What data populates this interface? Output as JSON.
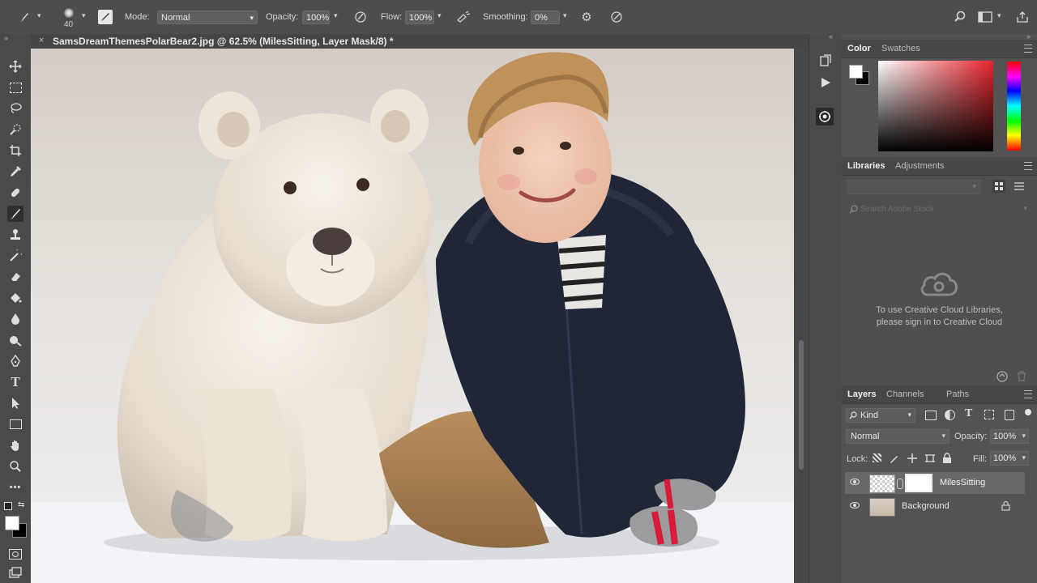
{
  "options_bar": {
    "brush_size": "40",
    "mode_label": "Mode:",
    "mode_value": "Normal",
    "opacity_label": "Opacity:",
    "opacity_value": "100%",
    "flow_label": "Flow:",
    "flow_value": "100%",
    "smoothing_label": "Smoothing:",
    "smoothing_value": "0%"
  },
  "document": {
    "tab_title": "SamsDreamThemesPolarBear2.jpg @ 62.5% (MilesSitting, Layer Mask/8) *"
  },
  "color_panel": {
    "tabs": [
      "Color",
      "Swatches"
    ],
    "foreground": "#ffffff",
    "background": "#000000",
    "hue_base": "#e8242c"
  },
  "libraries_panel": {
    "tabs": [
      "Libraries",
      "Adjustments"
    ],
    "search_placeholder": "Search Adobe Stock",
    "message_line1": "To use Creative Cloud Libraries,",
    "message_line2": "please sign in to Creative Cloud"
  },
  "layers_panel": {
    "tabs": [
      "Layers",
      "Channels",
      "Paths"
    ],
    "filter_kind": "Kind",
    "blend_mode": "Normal",
    "opacity_label": "Opacity:",
    "opacity_value": "100%",
    "lock_label": "Lock:",
    "fill_label": "Fill:",
    "fill_value": "100%",
    "layers": [
      {
        "name": "MilesSitting",
        "selected": true
      },
      {
        "name": "Background",
        "selected": false
      }
    ]
  }
}
